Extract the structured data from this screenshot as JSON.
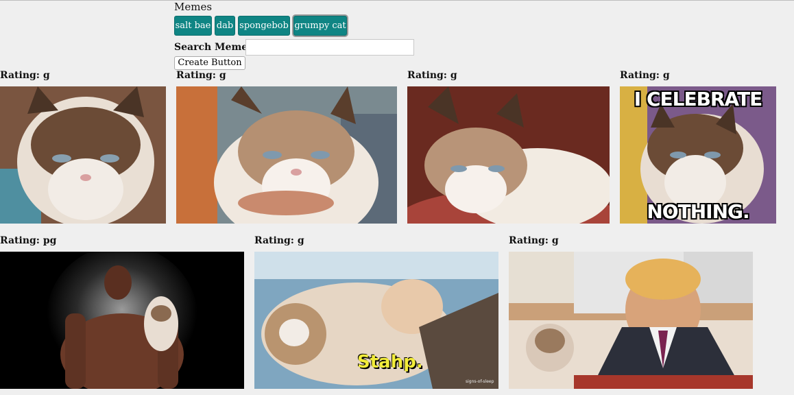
{
  "header": {
    "title": "Memes"
  },
  "tags": [
    {
      "label": "salt bae"
    },
    {
      "label": "dab"
    },
    {
      "label": "spongebob"
    },
    {
      "label": "grumpy cat",
      "active": true
    }
  ],
  "search": {
    "label": "Search Memes",
    "value": "",
    "placeholder": ""
  },
  "create_button": {
    "label": "Create Button"
  },
  "gifs": [
    {
      "rating": "Rating: g",
      "icon": "grumpy-cat-image"
    },
    {
      "rating": "Rating: g",
      "icon": "grumpy-cat-image"
    },
    {
      "rating": "Rating: g",
      "icon": "grumpy-cat-image"
    },
    {
      "rating": "Rating: g",
      "icon": "grumpy-cat-image",
      "caption_top": "I CELEBRATE",
      "caption_bottom": "NOTHING."
    },
    {
      "rating": "Rating: pg",
      "icon": "muscle-man-with-cat-image"
    },
    {
      "rating": "Rating: g",
      "icon": "grumpy-cat-image",
      "caption": "Stahp.",
      "watermark": "signs-of-sleep"
    },
    {
      "rating": "Rating: g",
      "icon": "man-with-grumpy-cat-image"
    }
  ],
  "colors": {
    "button_bg": "#0f8584",
    "page_bg": "#efefef"
  }
}
